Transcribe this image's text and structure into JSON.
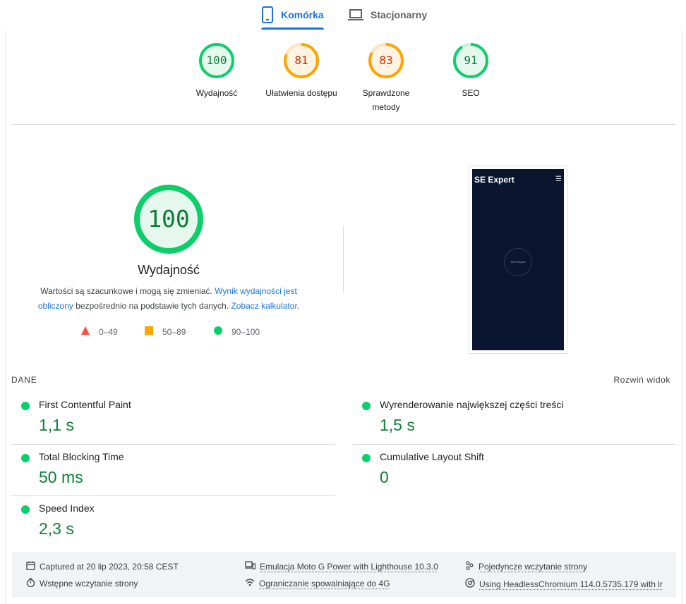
{
  "tabs": {
    "mobile": "Komórka",
    "desktop": "Stacjonarny"
  },
  "gauges": [
    {
      "value": "100",
      "label": "Wydajność",
      "score": 100,
      "color": "#0cce6b"
    },
    {
      "value": "81",
      "label": "Ułatwienia dostępu",
      "score": 81,
      "color": "#ffa400"
    },
    {
      "value": "83",
      "label_line1": "Sprawdzone",
      "label_line2": "metody",
      "score": 83,
      "color": "#ffa400"
    },
    {
      "value": "91",
      "label": "SEO",
      "score": 91,
      "color": "#0cce6b"
    }
  ],
  "performance": {
    "score": "100",
    "title": "Wydajność",
    "desc_1": "Wartości są szacunkowe i mogą się zmieniać.",
    "link_1": "Wynik wydajności jest obliczony",
    "desc_2": "bezpośrednio na podstawie tych danych.",
    "link_2": "Zobacz kalkulator",
    "desc_3": "."
  },
  "legend": {
    "fail": "0–49",
    "average": "50–89",
    "pass": "90–100"
  },
  "thumbnail": {
    "logo": "SE Expert",
    "menu_icon": "hamburger-icon",
    "loader_text": "SEO Expert"
  },
  "metrics_header": {
    "section": "DANE",
    "expand": "Rozwiń widok"
  },
  "metrics": [
    {
      "title": "First Contentful Paint",
      "value": "1,1 s"
    },
    {
      "title": "Wyrenderowanie największej części treści",
      "value": "1,5 s"
    },
    {
      "title": "Total Blocking Time",
      "value": "50 ms"
    },
    {
      "title": "Cumulative Layout Shift",
      "value": "0"
    },
    {
      "title": "Speed Index",
      "value": "2,3 s"
    }
  ],
  "footer": {
    "captured": "Captured at 20 lip 2023, 20:58 CEST",
    "initial": "Wstępne wczytanie strony",
    "emulation": "Emulacja Moto G Power with Lighthouse 10.3.0",
    "throttling": "Ograniczanie spowalniające do 4G",
    "single": "Pojedyncze wczytanie strony",
    "browser": "Using HeadlessChromium 114.0.5735.179 with lr"
  }
}
